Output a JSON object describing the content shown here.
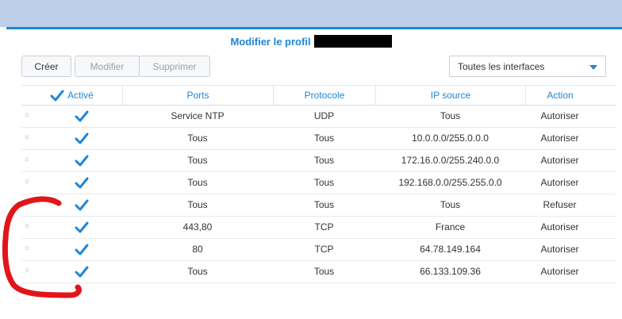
{
  "dialog": {
    "title": "Modifier le profil"
  },
  "toolbar": {
    "create_label": "Créer",
    "modify_label": "Modifier",
    "delete_label": "Supprimer",
    "interface_select": "Toutes les interfaces"
  },
  "table": {
    "headers": {
      "active": "Activé",
      "ports": "Ports",
      "protocol": "Protocole",
      "source_ip": "IP source",
      "action": "Action"
    },
    "rows": [
      {
        "active": true,
        "ports": "Service NTP",
        "protocol": "UDP",
        "source_ip": "Tous",
        "action": "Autoriser"
      },
      {
        "active": true,
        "ports": "Tous",
        "protocol": "Tous",
        "source_ip": "10.0.0.0/255.0.0.0",
        "action": "Autoriser"
      },
      {
        "active": true,
        "ports": "Tous",
        "protocol": "Tous",
        "source_ip": "172.16.0.0/255.240.0.0",
        "action": "Autoriser"
      },
      {
        "active": true,
        "ports": "Tous",
        "protocol": "Tous",
        "source_ip": "192.168.0.0/255.255.0.0",
        "action": "Autoriser"
      },
      {
        "active": true,
        "ports": "Tous",
        "protocol": "Tous",
        "source_ip": "Tous",
        "action": "Refuser"
      },
      {
        "active": true,
        "ports": "443,80",
        "protocol": "TCP",
        "source_ip": "France",
        "action": "Autoriser"
      },
      {
        "active": true,
        "ports": "80",
        "protocol": "TCP",
        "source_ip": "64.78.149.164",
        "action": "Autoriser"
      },
      {
        "active": true,
        "ports": "Tous",
        "protocol": "Tous",
        "source_ip": "66.133.109.36",
        "action": "Autoriser"
      }
    ]
  },
  "colors": {
    "accent": "#1f86d8",
    "top_band": "#bcd0ea",
    "annotation": "#e0161b"
  }
}
